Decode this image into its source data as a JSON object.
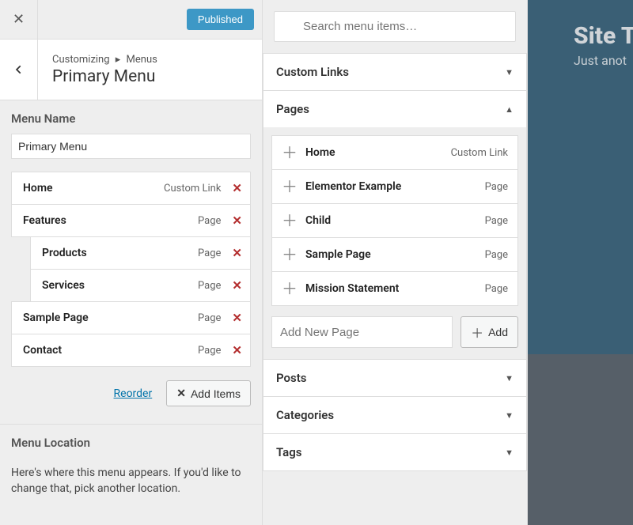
{
  "topbar": {
    "published_label": "Published"
  },
  "header": {
    "crumb_root": "Customizing",
    "crumb_leaf": "Menus",
    "title": "Primary Menu"
  },
  "menu_name": {
    "label": "Menu Name",
    "value": "Primary Menu"
  },
  "menu_items": [
    {
      "name": "Home",
      "type": "Custom Link",
      "indent": false
    },
    {
      "name": "Features",
      "type": "Page",
      "indent": false
    },
    {
      "name": "Products",
      "type": "Page",
      "indent": true
    },
    {
      "name": "Services",
      "type": "Page",
      "indent": true
    },
    {
      "name": "Sample Page",
      "type": "Page",
      "indent": false
    },
    {
      "name": "Contact",
      "type": "Page",
      "indent": false
    }
  ],
  "list_actions": {
    "reorder": "Reorder",
    "add_items": "Add Items"
  },
  "menu_location": {
    "heading": "Menu Location",
    "text": "Here's where this menu appears. If you'd like to change that, pick another location."
  },
  "search": {
    "placeholder": "Search menu items…"
  },
  "accordions": {
    "custom_links": "Custom Links",
    "pages": "Pages",
    "posts": "Posts",
    "categories": "Categories",
    "tags": "Tags"
  },
  "available_pages": [
    {
      "title": "Home",
      "kind": "Custom Link"
    },
    {
      "title": "Elementor Example",
      "kind": "Page"
    },
    {
      "title": "Child",
      "kind": "Page"
    },
    {
      "title": "Sample Page",
      "kind": "Page"
    },
    {
      "title": "Mission Statement",
      "kind": "Page"
    }
  ],
  "add_new_page": {
    "placeholder": "Add New Page",
    "button": "Add"
  },
  "preview": {
    "site_title": "Site Ti",
    "tagline": "Just anot"
  }
}
